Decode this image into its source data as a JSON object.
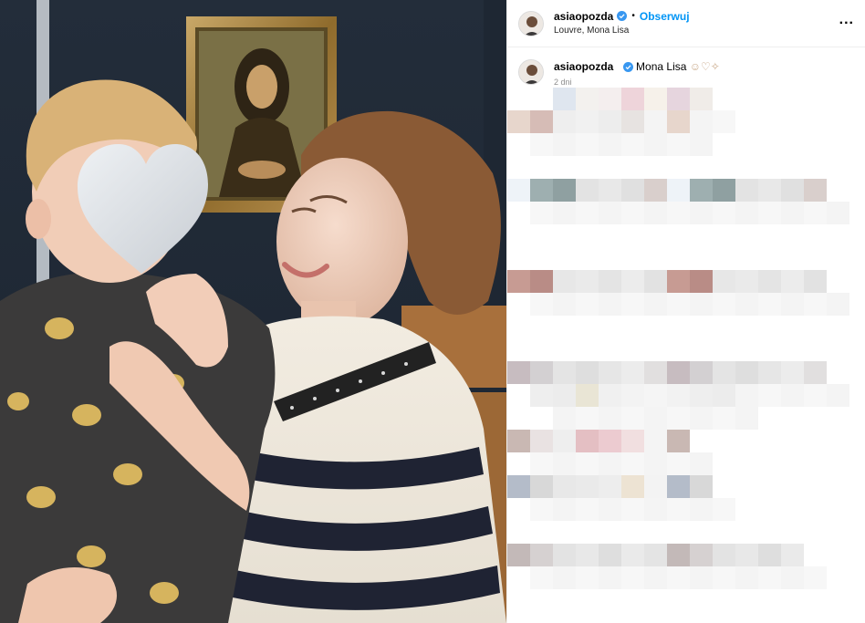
{
  "post": {
    "username": "asiaopozda",
    "follow_label": "Obserwuj",
    "separator": "•",
    "location": "Louvre, Mona Lisa",
    "more_label": "...",
    "caption_text": "Mona Lisa",
    "caption_emoji": "☺♡✧",
    "time_ago": "2 dni"
  },
  "colors": {
    "link": "#0095f6",
    "verified": "#3897f0",
    "muted": "#8e8e8e",
    "divider": "#efefef"
  },
  "icons": [
    "verified-badge-icon",
    "more-options-icon"
  ]
}
